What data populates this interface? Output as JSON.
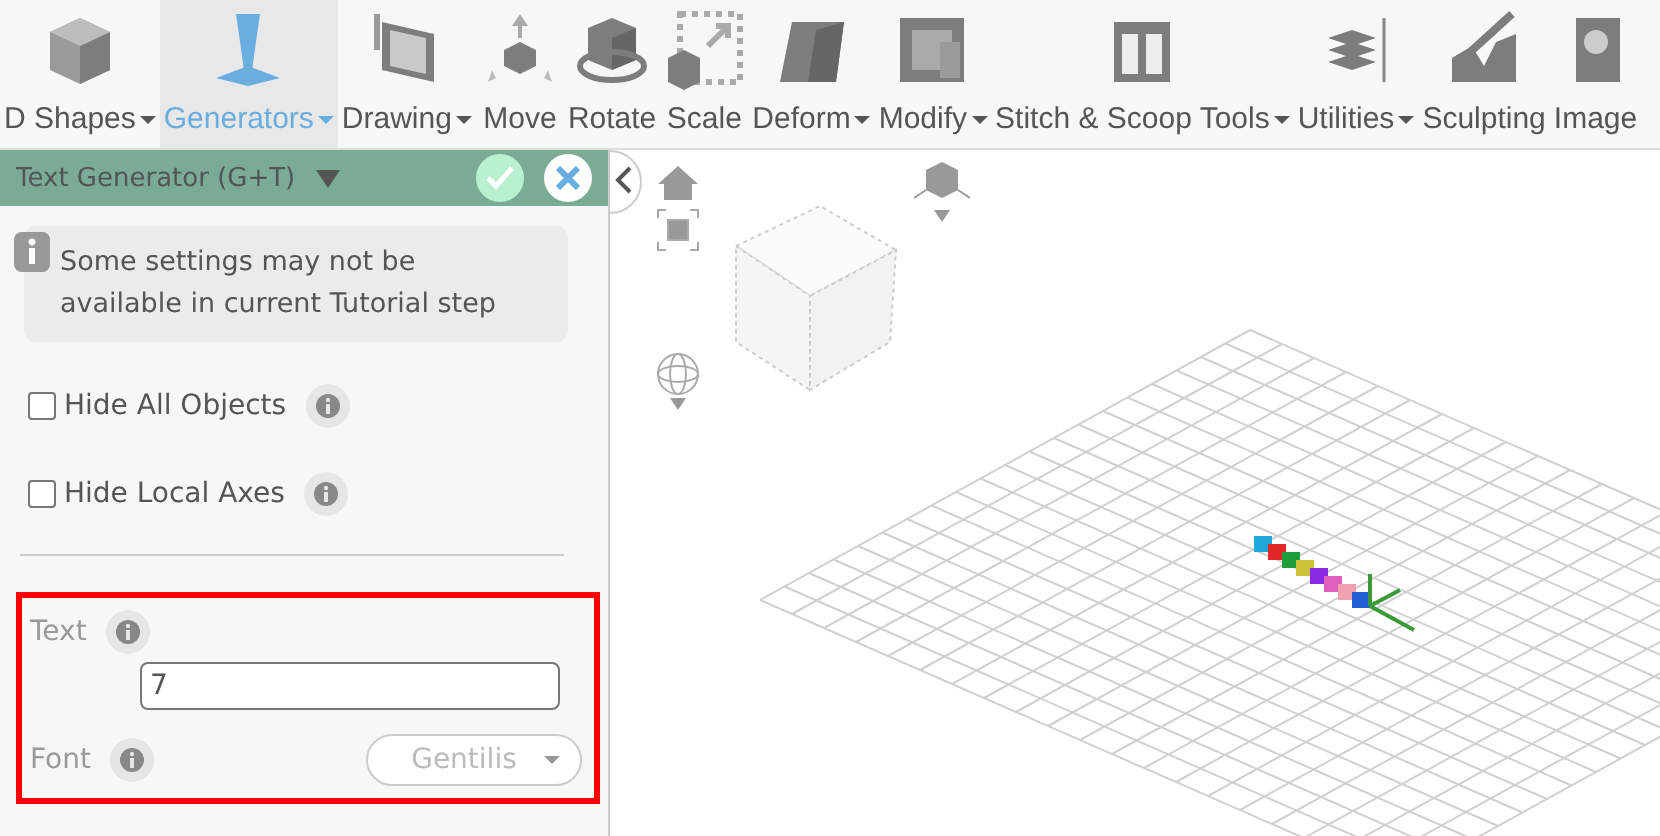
{
  "toolbar": [
    {
      "label": "D Shapes",
      "dropdown": true,
      "selected": false
    },
    {
      "label": "Generators",
      "dropdown": true,
      "selected": true
    },
    {
      "label": "Drawing",
      "dropdown": true,
      "selected": false
    },
    {
      "label": "Move",
      "dropdown": false,
      "selected": false
    },
    {
      "label": "Rotate",
      "dropdown": false,
      "selected": false
    },
    {
      "label": "Scale",
      "dropdown": false,
      "selected": false
    },
    {
      "label": "Deform",
      "dropdown": true,
      "selected": false
    },
    {
      "label": "Modify",
      "dropdown": true,
      "selected": false
    },
    {
      "label": "Stitch & Scoop Tools",
      "dropdown": true,
      "selected": false
    },
    {
      "label": "Utilities",
      "dropdown": true,
      "selected": false
    },
    {
      "label": "Sculpting",
      "dropdown": false,
      "selected": false
    },
    {
      "label": "Image",
      "dropdown": false,
      "selected": false
    }
  ],
  "panel": {
    "title": "Text Generator (G+T)",
    "notice": "Some settings may not be available in current Tutorial step",
    "checkboxes": [
      {
        "label": "Hide All Objects",
        "checked": false
      },
      {
        "label": "Hide Local Axes",
        "checked": false
      }
    ],
    "text_options": {
      "highlighted": true,
      "text_label": "Text",
      "text_value": "7",
      "font_label": "Font",
      "font_value": "Gentilis"
    }
  }
}
